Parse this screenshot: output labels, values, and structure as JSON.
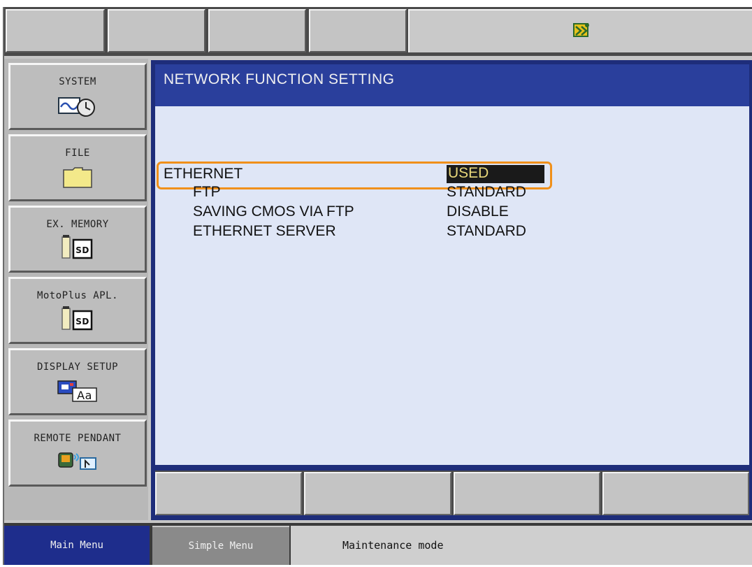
{
  "main": {
    "title": "NETWORK FUNCTION SETTING",
    "rows": [
      {
        "label": "ETHERNET",
        "value": "USED"
      },
      {
        "label": "FTP",
        "value": "STANDARD"
      },
      {
        "label": "SAVING CMOS VIA FTP",
        "value": "DISABLE"
      },
      {
        "label": "ETHERNET SERVER",
        "value": "STANDARD"
      }
    ]
  },
  "menu": {
    "items": [
      {
        "label": "SYSTEM",
        "icon": "system-clock-icon"
      },
      {
        "label": "FILE",
        "icon": "folder-icon"
      },
      {
        "label": "EX. MEMORY",
        "icon": "sd-card-icon"
      },
      {
        "label": "MotoPlus APL.",
        "icon": "sd-card-icon"
      },
      {
        "label": "DISPLAY SETUP",
        "icon": "display-font-icon"
      },
      {
        "label": "REMOTE PENDANT",
        "icon": "remote-pendant-icon"
      }
    ]
  },
  "bottom": {
    "main_menu": "Main Menu",
    "simple_menu": "Simple Menu",
    "mode": "Maintenance mode"
  },
  "colors": {
    "title_bg": "#2a3f9c",
    "content_bg": "#dfe6f6",
    "highlight": "#f0901a",
    "selected_value_bg": "#1a1a1a",
    "selected_value_text": "#e8d77a"
  }
}
